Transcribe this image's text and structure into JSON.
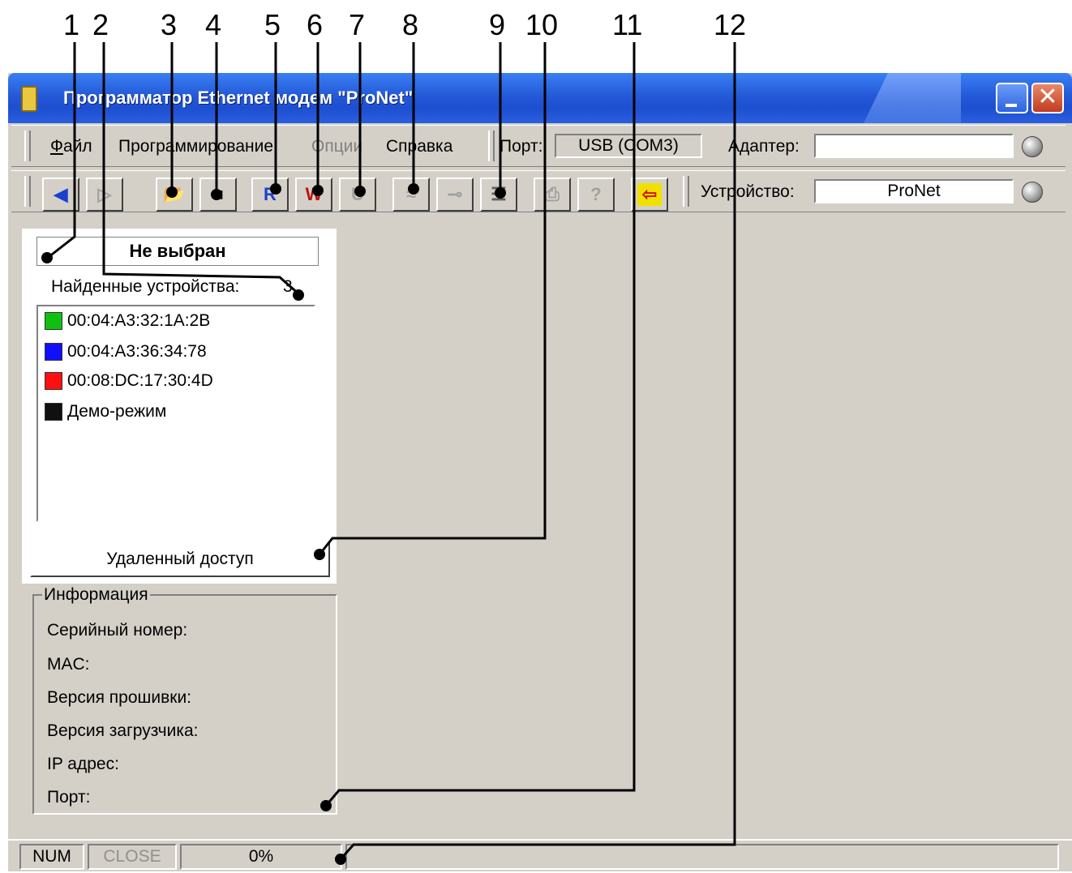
{
  "callout_numbers": [
    "1",
    "2",
    "3",
    "4",
    "5",
    "6",
    "7",
    "8",
    "9",
    "10",
    "11",
    "12"
  ],
  "window": {
    "title": "Программатор Ethernet модем \"ProNet\"",
    "close_glyph": "✕"
  },
  "menu": {
    "file": "Файл",
    "programming": "Программирование",
    "options": "Опции",
    "help": "Справка"
  },
  "port": {
    "label": "Порт:",
    "value": "USB (COM3)"
  },
  "adapter": {
    "label": "Адаптер:",
    "value": ""
  },
  "device": {
    "label": "Устройство:",
    "value": "ProNet"
  },
  "toolbar": [
    {
      "name": "back",
      "glyph": "◀",
      "color": "#1a3fd0",
      "enabled": true
    },
    {
      "name": "forward",
      "glyph": "▷",
      "color": "#a0a0a0",
      "enabled": false
    },
    {
      "name": "open",
      "glyph": "📂",
      "color": "#c8a000",
      "enabled": true
    },
    {
      "name": "save",
      "glyph": "■",
      "color": "#000000",
      "enabled": true
    },
    {
      "name": "read",
      "glyph": "R",
      "color": "#1a3fd0",
      "enabled": true
    },
    {
      "name": "write",
      "glyph": "W",
      "color": "#c01010",
      "enabled": true
    },
    {
      "name": "chip",
      "glyph": "U",
      "color": "#a0a0a0",
      "enabled": false
    },
    {
      "name": "erase",
      "glyph": "≈",
      "color": "#a0a0a0",
      "enabled": false
    },
    {
      "name": "key",
      "glyph": "⊸",
      "color": "#a0a0a0",
      "enabled": false
    },
    {
      "name": "list",
      "glyph": "☰",
      "color": "#606060",
      "enabled": true
    },
    {
      "name": "print",
      "glyph": "⎙",
      "color": "#a0a0a0",
      "enabled": false
    },
    {
      "name": "help",
      "glyph": "?",
      "color": "#a0a0a0",
      "enabled": false
    },
    {
      "name": "exit",
      "glyph": "⇦",
      "color": "#d01010",
      "enabled": true
    }
  ],
  "selection": {
    "current": "Не выбран",
    "found_label": "Найденные устройства:",
    "found_count": "3"
  },
  "devices": [
    {
      "label": "00:04:A3:32:1A:2B",
      "color": "#10c010"
    },
    {
      "label": "00:04:A3:36:34:78",
      "color": "#1010ff"
    },
    {
      "label": "00:08:DC:17:30:4D",
      "color": "#ff1010"
    },
    {
      "label": "Демо-режим",
      "color": "#101010"
    }
  ],
  "remote_button": "Удаленный доступ",
  "info": {
    "title": "Информация",
    "serial": "Серийный номер:",
    "mac": "MAC:",
    "firmware": "Версия прошивки:",
    "bootloader": "Версия загрузчика:",
    "ip": "IP адрес:",
    "port": "Порт:"
  },
  "status": {
    "num": "NUM",
    "close": "CLOSE",
    "progress": "0%"
  }
}
